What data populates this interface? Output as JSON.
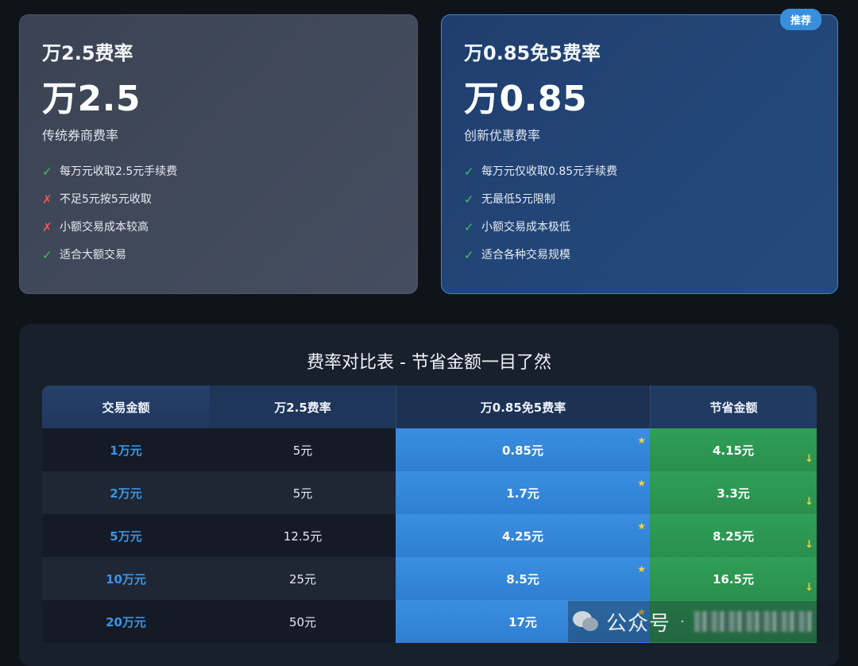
{
  "cards": {
    "left": {
      "title": "万2.5费率",
      "rate": "万2.5",
      "subtitle": "传统券商费率",
      "features": [
        {
          "mark": "✓",
          "ok": true,
          "text": "每万元收取2.5元手续费"
        },
        {
          "mark": "✗",
          "ok": false,
          "text": "不足5元按5元收取"
        },
        {
          "mark": "✗",
          "ok": false,
          "text": "小额交易成本较高"
        },
        {
          "mark": "✓",
          "ok": true,
          "text": "适合大额交易"
        }
      ]
    },
    "right": {
      "badge": "推荐",
      "title": "万0.85免5费率",
      "rate": "万0.85",
      "subtitle": "创新优惠费率",
      "features": [
        {
          "mark": "✓",
          "ok": true,
          "text": "每万元仅收取0.85元手续费"
        },
        {
          "mark": "✓",
          "ok": true,
          "text": "无最低5元限制"
        },
        {
          "mark": "✓",
          "ok": true,
          "text": "小额交易成本极低"
        },
        {
          "mark": "✓",
          "ok": true,
          "text": "适合各种交易规模"
        }
      ]
    }
  },
  "table": {
    "title": "费率对比表 - 节省金额一目了然",
    "headers": [
      "交易金额",
      "万2.5费率",
      "万0.85免5费率",
      "节省金额"
    ],
    "star_glyph": "★",
    "arrow_glyph": "↓",
    "rows": [
      [
        "1万元",
        "5元",
        "0.85元",
        "4.15元"
      ],
      [
        "2万元",
        "5元",
        "1.7元",
        "3.3元"
      ],
      [
        "5万元",
        "12.5元",
        "4.25元",
        "8.25元"
      ],
      [
        "10万元",
        "25元",
        "8.5元",
        "16.5元"
      ],
      [
        "20万元",
        "50元",
        "17元",
        ""
      ]
    ]
  },
  "watermark": {
    "label": "公众号",
    "separator": "·"
  },
  "colors": {
    "background": "#0f141b",
    "accent_blue": "#3a8fdd",
    "save_green": "#2f9f57",
    "check_green": "#43c06a",
    "cross_red": "#e65a5a",
    "star_yellow": "#f2d33a"
  }
}
